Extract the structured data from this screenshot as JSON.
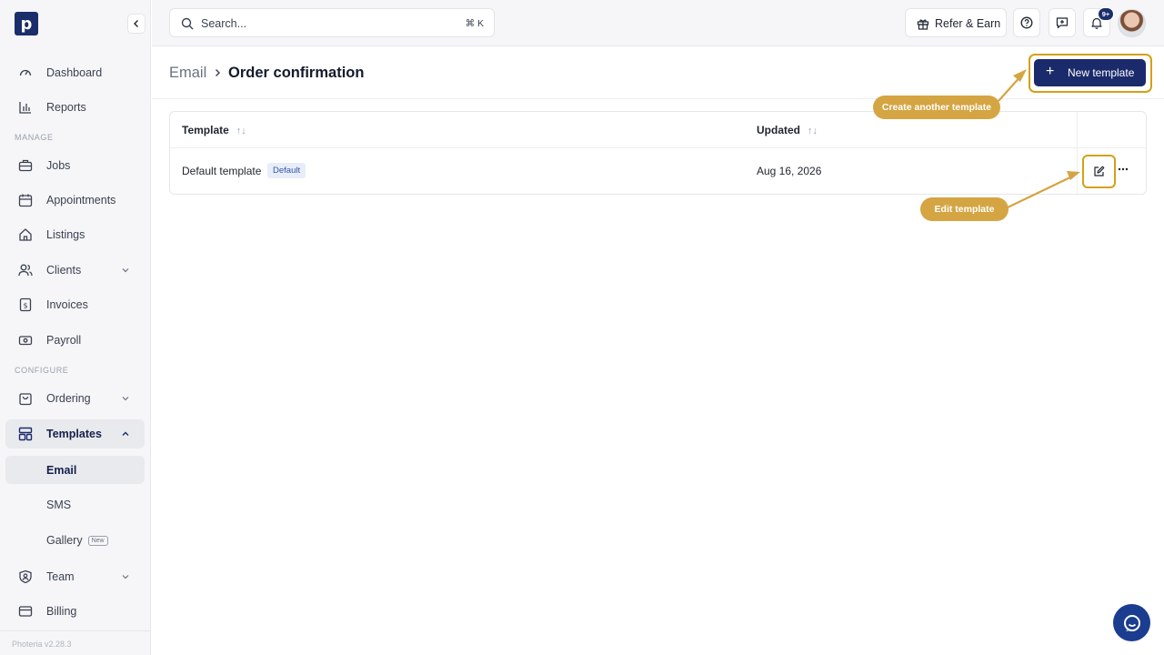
{
  "brand": {
    "logo_letter": "p"
  },
  "sidebar": {
    "items": [
      {
        "label": "Dashboard"
      },
      {
        "label": "Reports"
      }
    ],
    "section_manage": "MANAGE",
    "manage_items": [
      {
        "label": "Jobs"
      },
      {
        "label": "Appointments"
      },
      {
        "label": "Listings"
      },
      {
        "label": "Clients"
      },
      {
        "label": "Invoices"
      },
      {
        "label": "Payroll"
      }
    ],
    "section_configure": "CONFIGURE",
    "configure_items": [
      {
        "label": "Ordering"
      },
      {
        "label": "Templates"
      }
    ],
    "templates_sub": [
      {
        "label": "Email"
      },
      {
        "label": "SMS"
      },
      {
        "label": "Gallery",
        "badge": "New"
      }
    ],
    "bottom_items": [
      {
        "label": "Team"
      },
      {
        "label": "Billing"
      }
    ],
    "version": "Photeria v2.28.3"
  },
  "topbar": {
    "search_placeholder": "Search...",
    "search_shortcut": "⌘ K",
    "refer_label": "Refer & Earn",
    "notification_count": "9+"
  },
  "header": {
    "breadcrumb_root": "Email",
    "breadcrumb_current": "Order confirmation",
    "new_template_label": "New template"
  },
  "table": {
    "columns": [
      {
        "label": "Template"
      },
      {
        "label": "Updated"
      }
    ],
    "rows": [
      {
        "template": "Default template",
        "badge": "Default",
        "updated": "Aug 16, 2026"
      }
    ]
  },
  "callouts": {
    "create": "Create another template",
    "edit": "Edit template"
  },
  "colors": {
    "accent": "#1b2a6b",
    "highlight": "#d4a017",
    "callout": "#d4a542"
  }
}
